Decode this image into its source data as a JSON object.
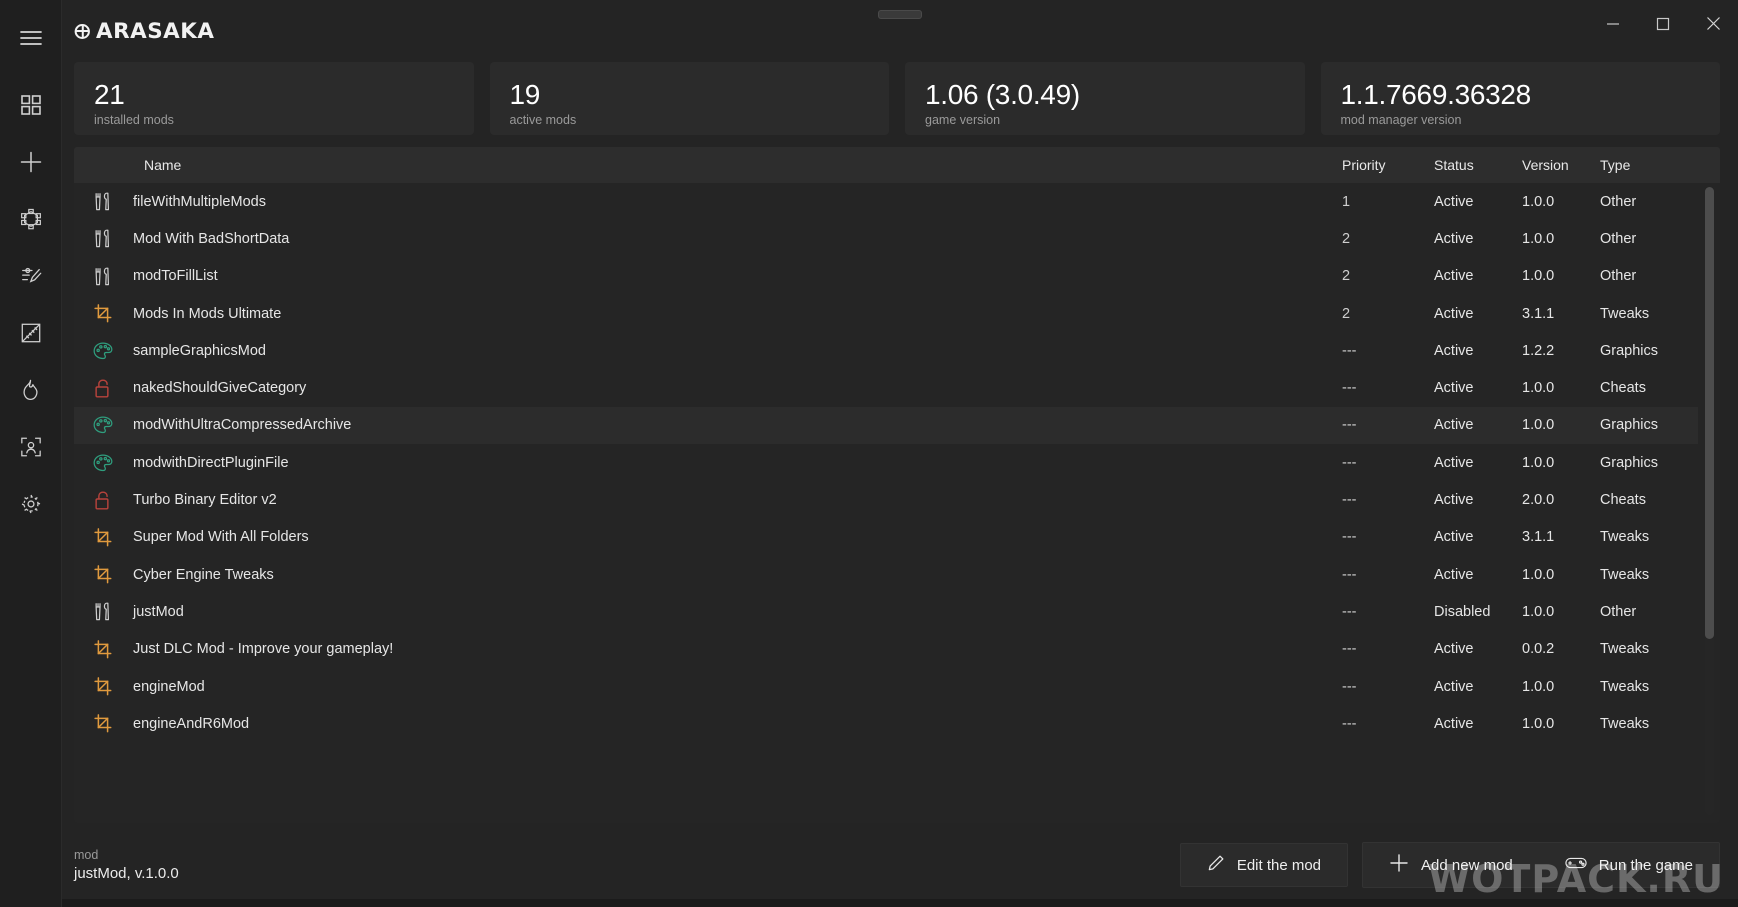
{
  "window": {
    "app_title": "ARASAKA",
    "controls": {
      "minimize": "minimize-icon",
      "maximize": "maximize-icon",
      "close": "close-icon"
    }
  },
  "sidebar": {
    "items": [
      {
        "name": "menu-icon",
        "label": "Menu"
      },
      {
        "name": "grid-icon",
        "label": "Dashboard"
      },
      {
        "name": "plus-icon",
        "label": "Add"
      },
      {
        "name": "cube-icon",
        "label": "Assets"
      },
      {
        "name": "edit-tools-icon",
        "label": "Editor"
      },
      {
        "name": "ruler-icon",
        "label": "Measure"
      },
      {
        "name": "flame-icon",
        "label": "Performance"
      },
      {
        "name": "user-frame-icon",
        "label": "Profile"
      },
      {
        "name": "gear-icon",
        "label": "Settings"
      }
    ]
  },
  "stats": [
    {
      "value": "21",
      "label": "installed mods"
    },
    {
      "value": "19",
      "label": "active mods"
    },
    {
      "value": "1.06 (3.0.49)",
      "label": "game version"
    },
    {
      "value": "1.1.7669.36328",
      "label": "mod manager version"
    }
  ],
  "table": {
    "columns": [
      "Name",
      "Priority",
      "Status",
      "Version",
      "Type"
    ],
    "rows": [
      {
        "icon": "tools-icon",
        "name": "fileWithMultipleMods",
        "priority": "1",
        "status": "Active",
        "version": "1.0.0",
        "type": "Other"
      },
      {
        "icon": "tools-icon",
        "name": "Mod With BadShortData",
        "priority": "2",
        "status": "Active",
        "version": "1.0.0",
        "type": "Other"
      },
      {
        "icon": "tools-icon",
        "name": "modToFillList",
        "priority": "2",
        "status": "Active",
        "version": "1.0.0",
        "type": "Other"
      },
      {
        "icon": "crop-icon",
        "name": "Mods In Mods Ultimate",
        "priority": "2",
        "status": "Active",
        "version": "3.1.1",
        "type": "Tweaks"
      },
      {
        "icon": "palette-icon",
        "name": "sampleGraphicsMod",
        "priority": "---",
        "status": "Active",
        "version": "1.2.2",
        "type": "Graphics"
      },
      {
        "icon": "lock-icon",
        "name": "nakedShouldGiveCategory",
        "priority": "---",
        "status": "Active",
        "version": "1.0.0",
        "type": "Cheats"
      },
      {
        "icon": "palette-icon",
        "name": "modWithUltraCompressedArchive",
        "priority": "---",
        "status": "Active",
        "version": "1.0.0",
        "type": "Graphics"
      },
      {
        "icon": "palette-icon",
        "name": "modwithDirectPluginFile",
        "priority": "---",
        "status": "Active",
        "version": "1.0.0",
        "type": "Graphics"
      },
      {
        "icon": "lock-icon",
        "name": "Turbo Binary Editor v2",
        "priority": "---",
        "status": "Active",
        "version": "2.0.0",
        "type": "Cheats"
      },
      {
        "icon": "crop-icon",
        "name": "Super Mod With All Folders",
        "priority": "---",
        "status": "Active",
        "version": "3.1.1",
        "type": "Tweaks"
      },
      {
        "icon": "crop-icon",
        "name": "Cyber Engine Tweaks",
        "priority": "---",
        "status": "Active",
        "version": "1.0.0",
        "type": "Tweaks"
      },
      {
        "icon": "tools-icon",
        "name": "justMod",
        "priority": "---",
        "status": "Disabled",
        "version": "1.0.0",
        "type": "Other"
      },
      {
        "icon": "crop-icon",
        "name": "Just DLC Mod - Improve your gameplay!",
        "priority": "---",
        "status": "Active",
        "version": "0.0.2",
        "type": "Tweaks"
      },
      {
        "icon": "crop-icon",
        "name": "engineMod",
        "priority": "---",
        "status": "Active",
        "version": "1.0.0",
        "type": "Tweaks"
      },
      {
        "icon": "crop-icon",
        "name": "engineAndR6Mod",
        "priority": "---",
        "status": "Active",
        "version": "1.0.0",
        "type": "Tweaks"
      }
    ],
    "highlighted_row_index": 6
  },
  "footer": {
    "selected_label": "mod",
    "selected_value": "justMod, v.1.0.0",
    "edit_button": "Edit the mod",
    "add_button": "Add new mod",
    "run_button": "Run the game"
  },
  "watermark": "WOTPACK.RU",
  "colors": {
    "background": "#242424",
    "rail": "#1f1f1f",
    "card": "#2b2b2b",
    "panel": "#252525",
    "header": "#2d2d2d",
    "row_alt": "#2c2c2c",
    "text": "#e6e6e6",
    "muted": "#9a9a9a",
    "tweaks": "#e09a3e",
    "graphics": "#2f9e7e",
    "cheats": "#b8433c",
    "other": "#cfcfcf"
  }
}
